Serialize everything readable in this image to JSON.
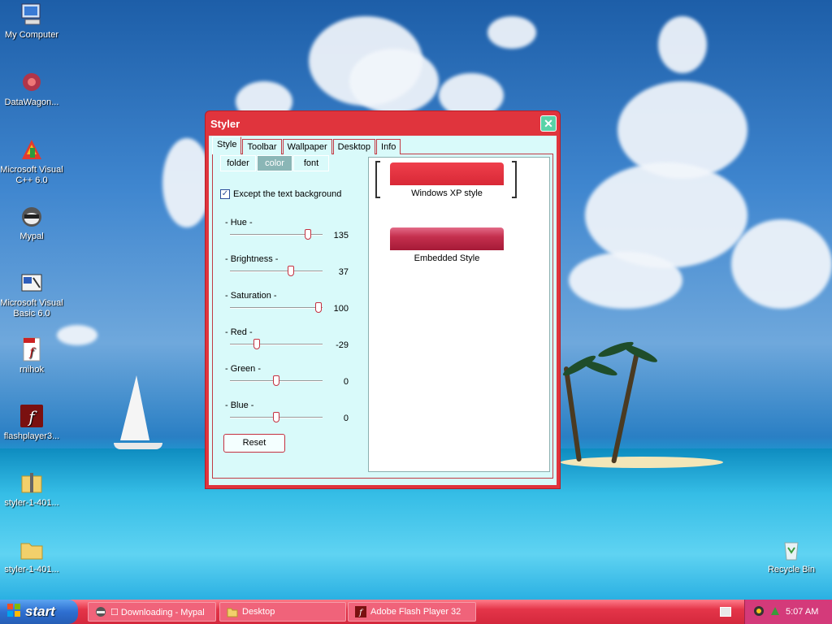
{
  "desktop": {
    "icons": [
      {
        "name": "my-computer-icon",
        "label": "My Computer"
      },
      {
        "name": "datawagon-icon",
        "label": "DataWagon..."
      },
      {
        "name": "visual-cpp-icon",
        "label": "Microsoft Visual\nC++ 6.0"
      },
      {
        "name": "mypal-icon",
        "label": "Mypal"
      },
      {
        "name": "visual-basic-icon",
        "label": "Microsoft Visual\nBasic 6.0"
      },
      {
        "name": "swf-file-icon",
        "label": "rnihok"
      },
      {
        "name": "flash-player-icon",
        "label": "flashplayer3..."
      },
      {
        "name": "zip-folder-icon",
        "label": "styler-1-401..."
      },
      {
        "name": "folder-icon",
        "label": "styler-1-401..."
      },
      {
        "name": "recycle-bin-icon",
        "label": "Recycle Bin"
      }
    ]
  },
  "window": {
    "title": "Styler",
    "close_glyph": "✕",
    "tabs": [
      {
        "label": "Style",
        "active": true
      },
      {
        "label": "Toolbar",
        "active": false
      },
      {
        "label": "Wallpaper",
        "active": false
      },
      {
        "label": "Desktop",
        "active": false
      },
      {
        "label": "Info",
        "active": false
      }
    ],
    "subtabs": [
      {
        "label": "folder",
        "active": false
      },
      {
        "label": "color",
        "active": true
      },
      {
        "label": "font",
        "active": false
      }
    ],
    "checkbox": {
      "label": "Except the text background",
      "checked": true,
      "mark": "✓"
    },
    "sliders": [
      {
        "label": "- Hue -",
        "value": "135",
        "fraction": 0.87
      },
      {
        "label": "- Brightness -",
        "value": "37",
        "fraction": 0.67
      },
      {
        "label": "- Saturation -",
        "value": "100",
        "fraction": 0.99
      },
      {
        "label": "- Red -",
        "value": "-29",
        "fraction": 0.27
      },
      {
        "label": "- Green -",
        "value": "0",
        "fraction": 0.5
      },
      {
        "label": "- Blue -",
        "value": "0",
        "fraction": 0.5
      }
    ],
    "reset_label": "Reset",
    "preview": {
      "xp_label": "Windows XP style",
      "embedded_label": "Embedded Style"
    }
  },
  "taskbar": {
    "start_label": "start",
    "buttons": [
      {
        "label": "☐ Downloading - Mypal"
      },
      {
        "label": "Desktop"
      },
      {
        "label": "Adobe Flash Player 32"
      }
    ],
    "clock": "5:07 AM"
  },
  "colors": {
    "accent": "#e0343d",
    "client_bg": "#d9fafa",
    "taskbar": "#d4283d",
    "start": "#2e6fd1"
  }
}
